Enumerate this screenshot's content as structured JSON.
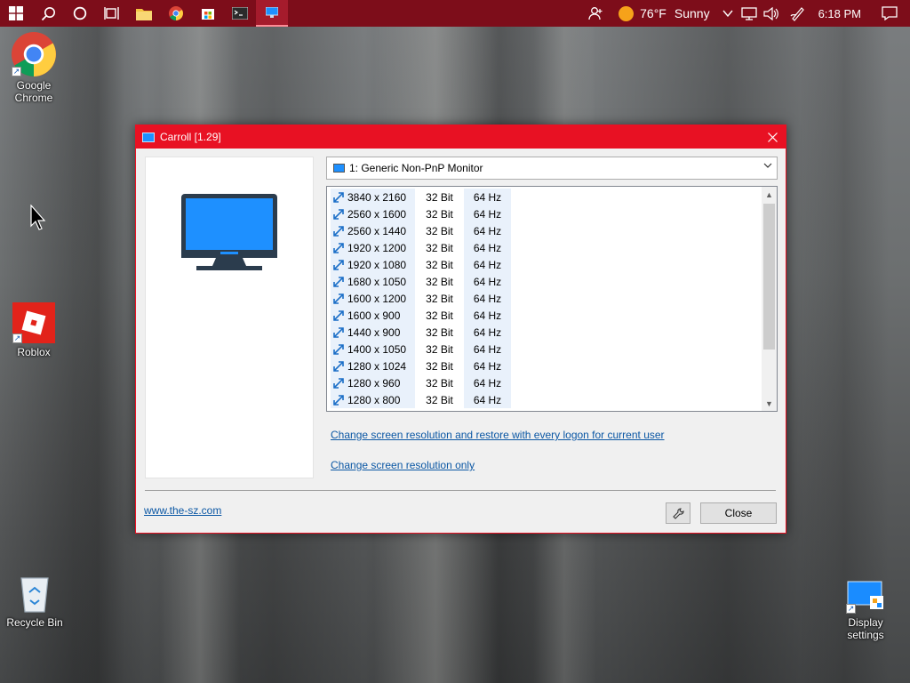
{
  "taskbar": {
    "weather": {
      "temperature": "76°F",
      "condition": "Sunny"
    },
    "clock": "6:18 PM",
    "pinned": [
      "windows-start",
      "search",
      "cortana",
      "task-view",
      "file-explorer",
      "chrome",
      "store",
      "terminal",
      "carroll"
    ]
  },
  "desktop": {
    "icons": [
      {
        "label": "Google Chrome"
      },
      {
        "label": "Roblox"
      },
      {
        "label": "Recycle Bin"
      },
      {
        "label": "Display settings"
      }
    ]
  },
  "window": {
    "title": "Carroll [1.29]",
    "monitor_select": "1: Generic Non-PnP Monitor",
    "resolutions": [
      {
        "res": "3840 x 2160",
        "bits": "32 Bit",
        "hz": "64 Hz"
      },
      {
        "res": "2560 x 1600",
        "bits": "32 Bit",
        "hz": "64 Hz"
      },
      {
        "res": "2560 x 1440",
        "bits": "32 Bit",
        "hz": "64 Hz"
      },
      {
        "res": "1920 x 1200",
        "bits": "32 Bit",
        "hz": "64 Hz"
      },
      {
        "res": "1920 x 1080",
        "bits": "32 Bit",
        "hz": "64 Hz"
      },
      {
        "res": "1680 x 1050",
        "bits": "32 Bit",
        "hz": "64 Hz"
      },
      {
        "res": "1600 x 1200",
        "bits": "32 Bit",
        "hz": "64 Hz"
      },
      {
        "res": "1600 x 900",
        "bits": "32 Bit",
        "hz": "64 Hz"
      },
      {
        "res": "1440 x 900",
        "bits": "32 Bit",
        "hz": "64 Hz"
      },
      {
        "res": "1400 x 1050",
        "bits": "32 Bit",
        "hz": "64 Hz"
      },
      {
        "res": "1280 x 1024",
        "bits": "32 Bit",
        "hz": "64 Hz"
      },
      {
        "res": "1280 x 960",
        "bits": "32 Bit",
        "hz": "64 Hz"
      },
      {
        "res": "1280 x 800",
        "bits": "32 Bit",
        "hz": "64 Hz"
      }
    ],
    "link_restore": "Change screen resolution and restore with every logon for current user",
    "link_only": "Change screen resolution only",
    "website": "www.the-sz.com",
    "close_label": "Close"
  },
  "colors": {
    "accent": "#e81123",
    "taskbar": "#7d0d1a",
    "link": "#0b57a4"
  }
}
